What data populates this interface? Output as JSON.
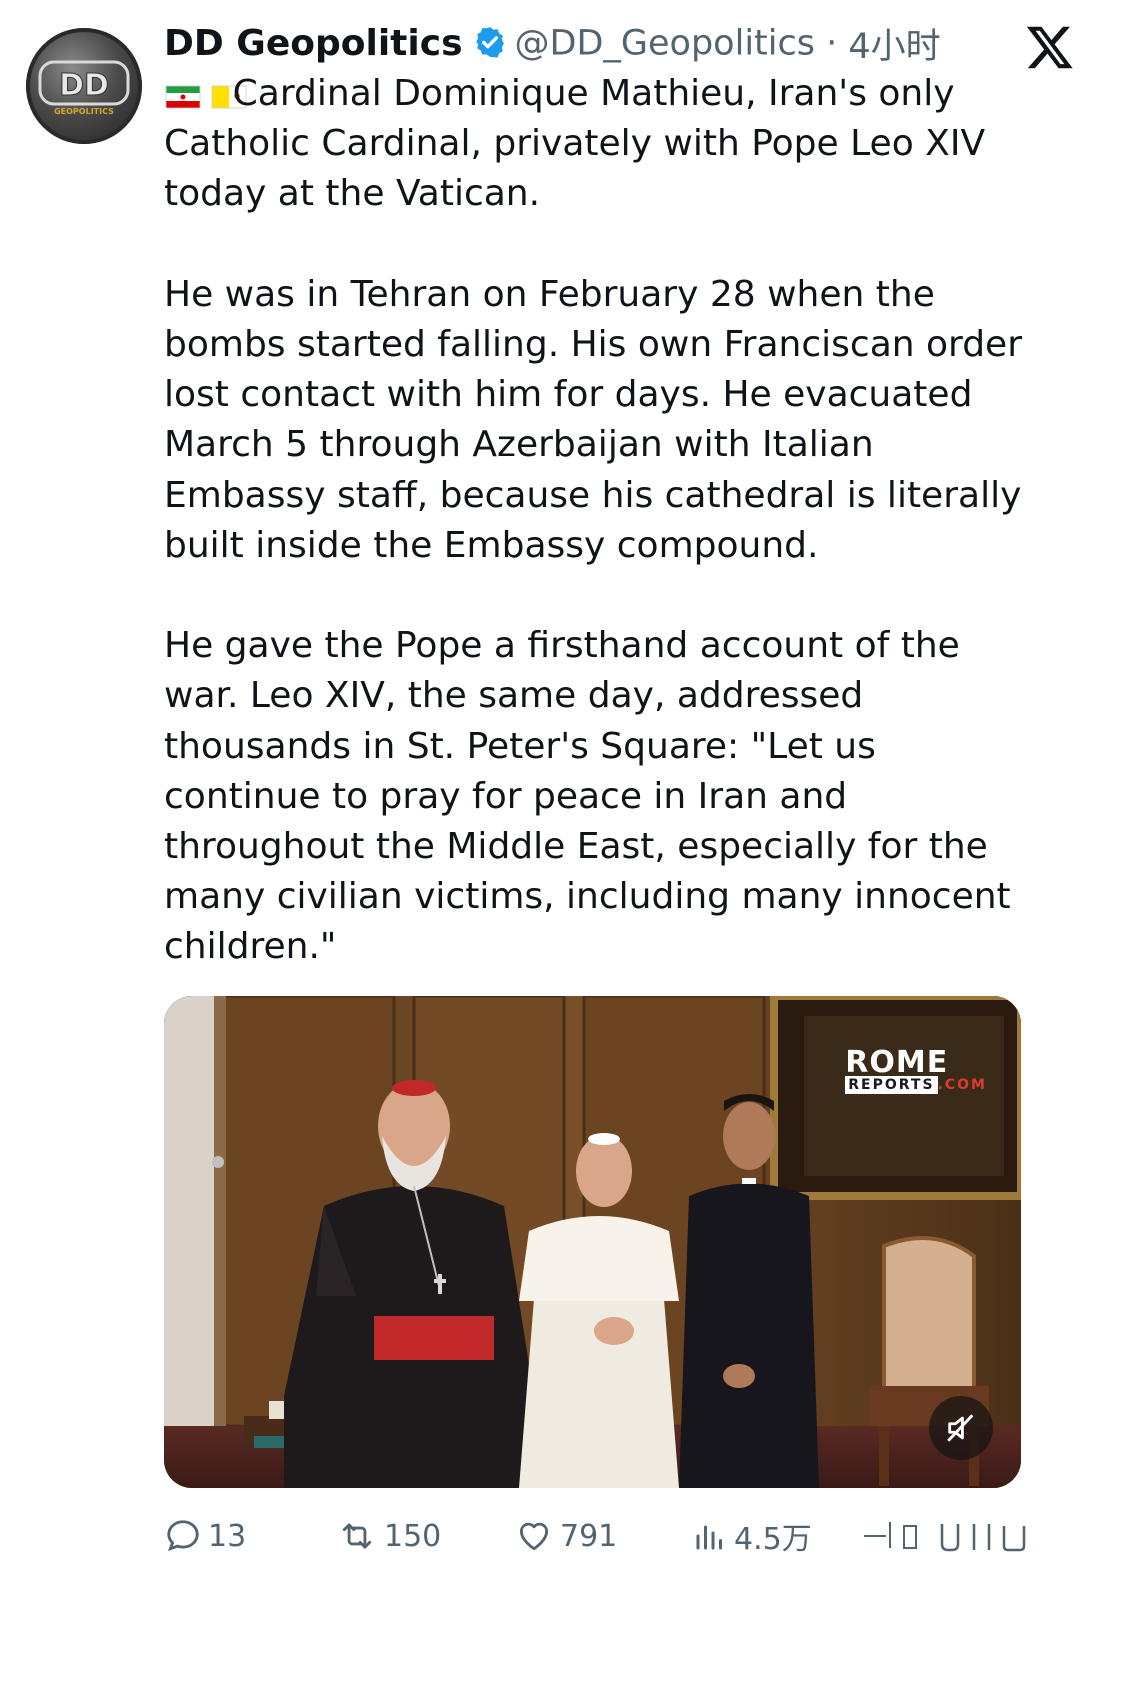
{
  "author": {
    "name": "DD Geopolitics",
    "handle": "@DD_Geopolitics",
    "time": "4小时",
    "avatar_text": "DD",
    "avatar_subtext": "GEOPOLITICS"
  },
  "tweet": {
    "flags": [
      "iran-flag",
      "vatican-flag"
    ],
    "text": "      Cardinal Dominique Mathieu, Iran's only\nCatholic Cardinal, privately with Pope Leo XIV\ntoday at the Vatican.\n\nHe was in Tehran on February 28 when the\nbombs started falling. His own Franciscan order\nlost contact with him for days. He evacuated\nMarch 5 through Azerbaijan with Italian\nEmbassy staff, because his cathedral is literally\nbuilt inside the Embassy compound.\n\nHe gave the Pope a firsthand account of the\nwar. Leo XIV, the same day, addressed\nthousands in St. Peter's Square: \"Let us\ncontinue to pray for peace in Iran and\nthroughout the Middle East, especially for the\nmany civilian victims, including many innocent\nchildren.\""
  },
  "media": {
    "watermark_top": "ROME",
    "watermark_reports": "REPORTS",
    "watermark_com": ".COM"
  },
  "actions": {
    "replies": "13",
    "reposts": "150",
    "likes": "791",
    "views": "4.5万"
  },
  "colors": {
    "verified": "#1d9bf0",
    "secondary_text": "#536471",
    "cassock_red": "#c0282a"
  }
}
